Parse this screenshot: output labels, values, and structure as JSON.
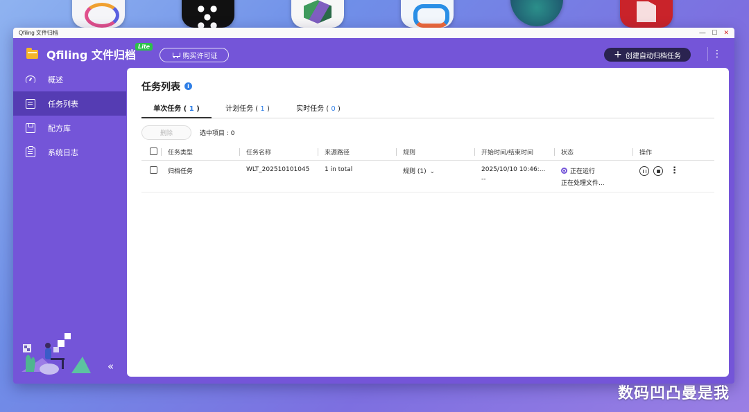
{
  "window": {
    "title": "Qfiling 文件归档",
    "controls": [
      "—",
      "☐",
      "✕"
    ]
  },
  "app": {
    "name": "Qfiling 文件归档",
    "badge": "Lite",
    "license_button": "购买许可证",
    "create_button": "创建自动归档任务",
    "more_icon": "⋮"
  },
  "sidebar": {
    "items": [
      {
        "label": "概述",
        "icon": "dashboard-icon"
      },
      {
        "label": "任务列表",
        "icon": "task-list-icon",
        "active": true
      },
      {
        "label": "配方库",
        "icon": "recipe-library-icon"
      },
      {
        "label": "系统日志",
        "icon": "clipboard-log-icon"
      }
    ],
    "collapse_icon": "«"
  },
  "main": {
    "title": "任务列表",
    "info_icon": "i",
    "tabs": [
      {
        "label": "单次任务",
        "count": "1",
        "active": true
      },
      {
        "label": "计划任务",
        "count": "1"
      },
      {
        "label": "实时任务",
        "count": "0"
      }
    ],
    "toolbar": {
      "delete_label": "删除",
      "selected_label": "选中项目 : 0"
    },
    "table": {
      "headers": [
        "任务类型",
        "任务名称",
        "来源路径",
        "规则",
        "开始时间/结束时间",
        "状态",
        "操作"
      ],
      "rows": [
        {
          "type": "归档任务",
          "name": "WLT_202510101045",
          "source": "1 in total",
          "rule": "规则 (1)",
          "start_time": "2025/10/10 10:46:...",
          "end_time": "--",
          "status": "正在运行",
          "status_detail": "正在处理文件..."
        }
      ]
    }
  },
  "colors": {
    "accent": "#7455d8",
    "sidebar_active": "#4a32a0",
    "create_button_bg": "#2a2350",
    "badge_green": "#2cc04a",
    "count_blue": "#2f7fe6"
  },
  "watermark": "数码凹凸曼是我"
}
